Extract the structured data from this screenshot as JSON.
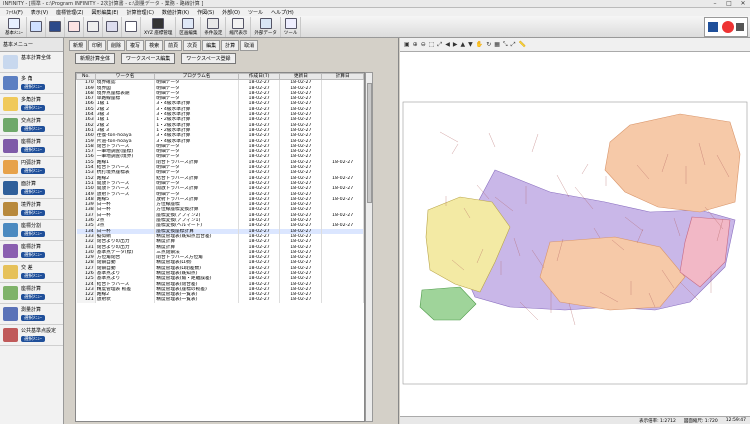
{
  "window": {
    "title": "INFINITY - [標準 - c:\\Program INFINITY - 2次計算書 - c:\\測量データ - 業務 - 路線計算 ]"
  },
  "menu": [
    "ﾌｧｲﾙ(F)",
    "表示(V)",
    "座標管理(Z)",
    "図形編集(E)",
    "計算管理(C)",
    "数値計算(K)",
    "作図(S)",
    "外部(O)",
    "ツール",
    "ヘルプ(H)"
  ],
  "toolbar": [
    {
      "label": "基本ﾒﾆｭｰ",
      "icon": "calculator-icon"
    },
    {
      "label": "",
      "icon": "brush-icon"
    },
    {
      "label": "",
      "icon": "triangle-icon"
    },
    {
      "label": "",
      "icon": "grid-icon"
    },
    {
      "label": "",
      "icon": "print-icon"
    },
    {
      "label": "",
      "icon": "layout-icon"
    },
    {
      "label": "",
      "icon": "stamp-icon"
    },
    {
      "label": "XYZ 座標管理",
      "icon": "xyz-icon"
    },
    {
      "label": "区画編集",
      "icon": "edit-icon"
    },
    {
      "label": "条件設定",
      "icon": "settings-icon"
    },
    {
      "label": "縮尺表示",
      "icon": "scale-icon"
    },
    {
      "label": "外部データ",
      "icon": "data-icon"
    },
    {
      "label": "ツール",
      "icon": "tool-icon"
    }
  ],
  "sidebar": {
    "header": "基本メニュー",
    "items": [
      {
        "label": "基本計算全体",
        "btn": ""
      },
      {
        "label": "多 角",
        "btn": "選択ﾒﾆｭｰ"
      },
      {
        "label": "多角計算",
        "btn": "選択ﾒﾆｭｰ"
      },
      {
        "label": "交点計算",
        "btn": "選択ﾒﾆｭｰ"
      },
      {
        "label": "座標計算",
        "btn": "選択ﾒﾆｭｰ"
      },
      {
        "label": "円弧計算",
        "btn": "選択ﾒﾆｭｰ"
      },
      {
        "label": "面計算",
        "btn": "選択ﾒﾆｭｰ"
      },
      {
        "label": "境界計算",
        "btn": "選択ﾒﾆｭｰ"
      },
      {
        "label": "座標分割",
        "btn": "選択ﾒﾆｭｰ"
      },
      {
        "label": "座標計算",
        "btn": "選択ﾒﾆｭｰ"
      },
      {
        "label": "交 差",
        "btn": "選択ﾒﾆｭｰ"
      },
      {
        "label": "座標計算",
        "btn": "選択ﾒﾆｭｰ"
      },
      {
        "label": "測量計算",
        "btn": "選択ﾒﾆｭｰ"
      },
      {
        "label": "公共基準点設定",
        "btn": "選択ﾒﾆｭｰ"
      }
    ]
  },
  "subtoolbar": [
    "新規",
    "印刷",
    "削除",
    "複写",
    "検索",
    "前頁",
    "次頁",
    "編集",
    "計算",
    "取消"
  ],
  "buttons": {
    "new_calc": "新規計算全体",
    "worksheet_edit": "ワークスペース編集",
    "worksheet_register": "ワークスペース登録"
  },
  "table": {
    "headers": [
      "No.",
      "ワーク名",
      "プログラム名",
      "作成日(T)",
      "更新日",
      "計算日"
    ],
    "rows": [
      [
        "170",
        "境界確認",
        "明細データ",
        "18-02-27",
        "18-02-27",
        ""
      ],
      [
        "169",
        "境界図",
        "明細データ",
        "18-02-27",
        "18-02-27",
        ""
      ],
      [
        "168",
        "境界点座標表題",
        "明細データ",
        "18-02-27",
        "18-02-27",
        ""
      ],
      [
        "167",
        "単路線座標",
        "明細データ",
        "18-02-27",
        "18-02-27",
        ""
      ],
      [
        "166",
        "1級 1",
        "3・4級水準計算",
        "18-02-27",
        "18-02-27",
        ""
      ],
      [
        "165",
        "2級 2",
        "3・4級水準計算",
        "18-02-27",
        "18-02-27",
        ""
      ],
      [
        "164",
        "3級 3",
        "3・4級水準計算",
        "18-02-27",
        "18-02-27",
        ""
      ],
      [
        "163",
        "1級 1",
        "1・2級水準計算",
        "18-02-27",
        "18-02-27",
        ""
      ],
      [
        "162",
        "2級 2",
        "1・2級水準計算",
        "18-02-27",
        "18-02-27",
        ""
      ],
      [
        "161",
        "3級 3",
        "1・2級水準計算",
        "18-02-27",
        "18-02-27",
        ""
      ],
      [
        "160",
        "往復-ton-hoaya",
        "3・4級水準計算",
        "18-02-27",
        "18-02-27",
        ""
      ],
      [
        "159",
        "片道-ton-hoaya",
        "3・4級水準計算",
        "18-02-27",
        "18-02-27",
        ""
      ],
      [
        "158",
        "閉合トラバース",
        "明細データ",
        "18-02-27",
        "18-02-27",
        ""
      ],
      [
        "157",
        "一筆地調査(座標)",
        "明細データ",
        "18-02-27",
        "18-02-27",
        ""
      ],
      [
        "156",
        "一筆地調査(境界)",
        "明細データ",
        "18-02-27",
        "18-02-27",
        ""
      ],
      [
        "155",
        "路線1",
        "閉合トラバース計算",
        "18-02-27",
        "18-02-27",
        "18-02-27"
      ],
      [
        "154",
        "結合トラバース",
        "明細データ",
        "18-02-27",
        "18-02-27",
        ""
      ],
      [
        "153",
        "杭打境界座標表",
        "明細データ",
        "18-02-27",
        "18-02-27",
        ""
      ],
      [
        "152",
        "路線2",
        "結合トラバース計算",
        "18-02-27",
        "18-02-27",
        "18-02-27"
      ],
      [
        "151",
        "開放トラバース",
        "明細データ",
        "18-02-27",
        "18-02-27",
        ""
      ],
      [
        "150",
        "開放トラバース",
        "開放トラバース計算",
        "18-02-27",
        "18-02-27",
        "18-02-27"
      ],
      [
        "149",
        "放射トラバース",
        "明細データ",
        "18-02-27",
        "18-02-27",
        ""
      ],
      [
        "148",
        "路線5",
        "放射トラバース計算",
        "18-02-27",
        "18-02-27",
        "18-02-27"
      ],
      [
        "139",
        "日一杯",
        "方位線座標",
        "18-02-27",
        "18-02-27",
        ""
      ],
      [
        "138",
        "日一杯",
        "方位線座標変換計算",
        "18-02-27",
        "18-02-27",
        ""
      ],
      [
        "137",
        "日一杯",
        "座標変換(アフィン2)",
        "18-02-27",
        "18-02-27",
        "18-02-27"
      ],
      [
        "136",
        "2点",
        "座標変換(アフィン1)",
        "18-02-27",
        "18-02-27",
        ""
      ],
      [
        "135",
        "3点",
        "座標変換(ヘルマート)",
        "18-02-27",
        "18-02-27",
        "18-02-27"
      ],
      [
        "134",
        "日一杯",
        "座標変換座標計算",
        "18-02-27",
        "18-02-27",
        ""
      ],
      [
        "133",
        "擬似網",
        "精度管理表(既知点出合差)",
        "18-02-27",
        "18-02-27",
        ""
      ],
      [
        "132",
        "閉合よりの出力",
        "精度計算",
        "18-02-27",
        "18-02-27",
        ""
      ],
      [
        "131",
        "閉合よりの出力",
        "精度計算",
        "18-02-27",
        "18-02-27",
        ""
      ],
      [
        "130",
        "基準点データ(標)",
        "三点閉鎖法",
        "18-02-27",
        "18-02-27",
        ""
      ],
      [
        "129",
        "方位角閉合",
        "閉合トラバース方位角",
        "18-02-27",
        "18-02-27",
        ""
      ],
      [
        "128",
        "閉鎖自動",
        "精度管理表(Ω項)",
        "18-02-27",
        "18-02-27",
        ""
      ],
      [
        "127",
        "閉鎖自動",
        "精度管理表(Ω閉差数)",
        "18-02-27",
        "18-02-27",
        ""
      ],
      [
        "126",
        "基準点より",
        "精度管理表(既知点)",
        "18-02-27",
        "18-02-27",
        ""
      ],
      [
        "125",
        "基準点より",
        "精度管理表(角・距離誤差)",
        "18-02-27",
        "18-02-27",
        ""
      ],
      [
        "124",
        "結合トラバース",
        "精度管理表(閉合差)",
        "18-02-27",
        "18-02-27",
        ""
      ],
      [
        "123",
        "精度管理表 較差",
        "精度管理表(座標の較差)",
        "18-02-27",
        "18-02-27",
        ""
      ],
      [
        "122",
        "路線2",
        "精度管理表(一覧表)",
        "18-02-27",
        "18-02-27",
        ""
      ],
      [
        "121",
        "放射状",
        "精度管理表(一覧表)",
        "18-02-27",
        "18-02-27",
        ""
      ]
    ],
    "selected_index": 28
  },
  "mapbar_icons": [
    "print-icon",
    "zoom-in-icon",
    "zoom-out-icon",
    "zoom-window-icon",
    "zoom-fit-icon",
    "pan-left-icon",
    "pan-right-icon",
    "pan-up-icon",
    "pan-down-icon",
    "hand-icon",
    "refresh-icon",
    "grid-icon",
    "expand-icon",
    "shrink-icon",
    "ruler-icon"
  ],
  "status": {
    "zoom": "表示倍率: 1:2712",
    "scale": "図面縮尺: 1:720",
    "time": "12:59:47"
  },
  "colors": {
    "purple": "#c9b7e8",
    "yellow": "#f3eaa4",
    "orange": "#f6c9a8",
    "green": "#9fd49a",
    "pink": "#f2b8c6"
  }
}
